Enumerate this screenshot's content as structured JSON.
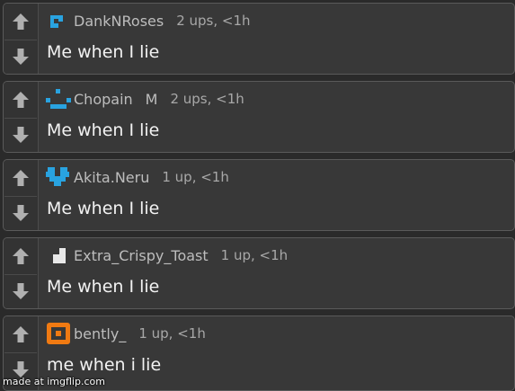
{
  "comments": [
    {
      "username": "DankNRoses",
      "flair": "",
      "meta": "2 ups, <1h",
      "text": "Me when I lie",
      "avatar": "dank-avatar-icon",
      "color": "#29a3e0"
    },
    {
      "username": "Chopain",
      "flair": "M",
      "meta": "2 ups, <1h",
      "text": "Me when I lie",
      "avatar": "smiley-avatar-icon",
      "color": "#29a3e0"
    },
    {
      "username": "Akita.Neru",
      "flair": "",
      "meta": "1 up, <1h",
      "text": "Me when I lie",
      "avatar": "heart-avatar-icon",
      "color": "#29a3e0"
    },
    {
      "username": "Extra_Crispy_Toast",
      "flair": "",
      "meta": "1 up, <1h",
      "text": "Me when I lie",
      "avatar": "stairs-avatar-icon",
      "color": "#e8e8e8"
    },
    {
      "username": "bently_",
      "flair": "",
      "meta": "1 up, <1h",
      "text": "me when i lie",
      "avatar": "square-avatar-icon",
      "color": "#f07a12"
    }
  ],
  "icons": {
    "upvote": "upvote-arrow-icon",
    "downvote": "downvote-arrow-icon"
  },
  "watermark": "made at imgflip.com"
}
